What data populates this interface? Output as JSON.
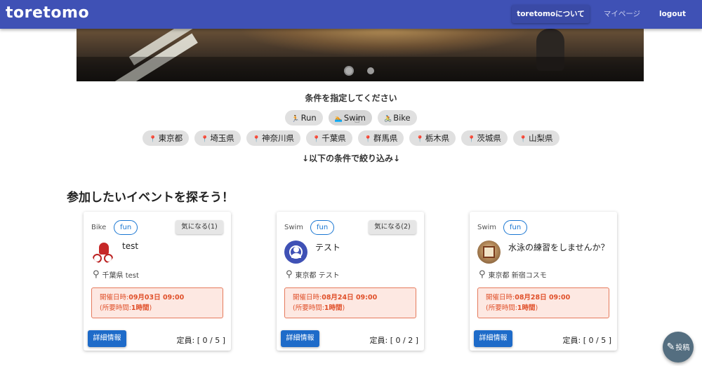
{
  "header": {
    "brand": "toretomo",
    "nav": [
      {
        "label": "toretomoについて"
      },
      {
        "label": "マイページ"
      },
      {
        "label": "logout"
      }
    ]
  },
  "filters": {
    "title": "条件を指定してください",
    "sports": [
      "Run",
      "Swim",
      "Bike"
    ],
    "prefectures": [
      "東京都",
      "埼玉県",
      "神奈川県",
      "千葉県",
      "群馬県",
      "栃木県",
      "茨城県",
      "山梨県"
    ],
    "narrow_label": "↓以下の条件で絞り込み↓"
  },
  "section_title": "参加したいイベントを探そう！",
  "events": [
    {
      "sport": "Bike",
      "tag": "fun",
      "kininaru": "気になる(1)",
      "title": "test",
      "location": "千葉県 test",
      "date_label": "開催日時:",
      "date_value": "09月03日 09:00",
      "duration_label": "(所要時間:",
      "duration_value": "1時間",
      "duration_close": ")",
      "detail_label": "詳細情報",
      "capacity": "定員: [ 0 / 5 ]"
    },
    {
      "sport": "Swim",
      "tag": "fun",
      "kininaru": "気になる(2)",
      "title": "テスト",
      "location": "東京都 テスト",
      "date_label": "開催日時:",
      "date_value": "08月24日 09:00",
      "duration_label": "(所要時間:",
      "duration_value": "1時間",
      "duration_close": ")",
      "detail_label": "詳細情報",
      "capacity": "定員: [ 0 / 2 ]"
    },
    {
      "sport": "Swim",
      "tag": "fun",
      "title": "水泳の練習をしませんか？",
      "location": "東京都 新宿コスモ",
      "date_label": "開催日時:",
      "date_value": "08月28日 09:00",
      "duration_label": "(所要時間:",
      "duration_value": "1時間",
      "duration_close": ")",
      "detail_label": "詳細情報",
      "capacity": "定員: [ 0 / 5 ]"
    }
  ],
  "fab": {
    "label": "投稿"
  },
  "colors": {
    "appbar": "#3f51b5",
    "primary_button": "#1e6bc9",
    "date_text": "#e0502a",
    "date_bg": "#fde8e2"
  }
}
